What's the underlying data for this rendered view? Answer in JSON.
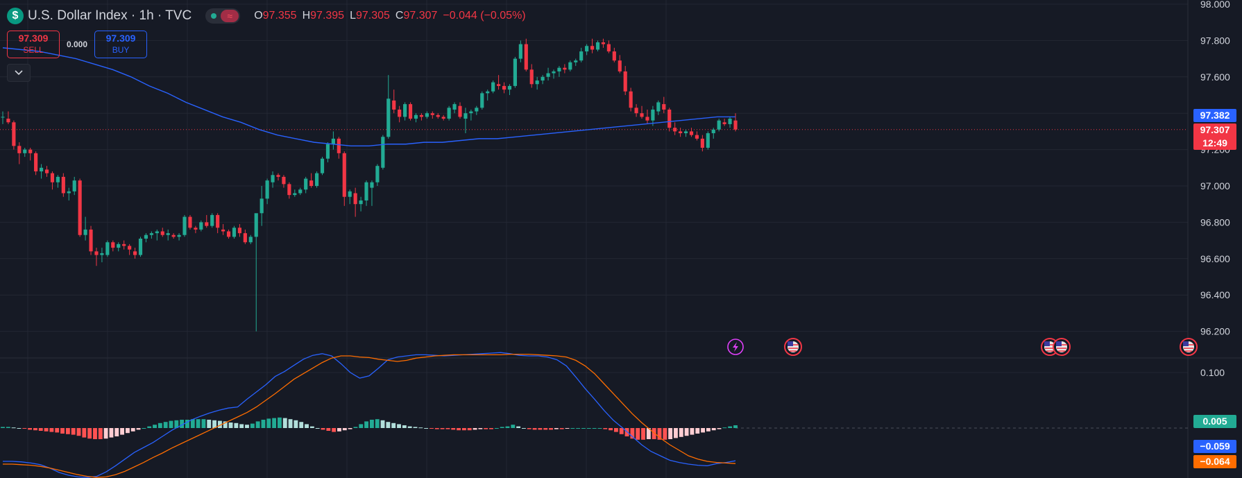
{
  "legend": {
    "logo_glyph": "$",
    "title": "U.S. Dollar Index · 1h · TVC",
    "toggle_glyph": "≈",
    "ohlc": [
      {
        "key": "O",
        "value": "97.355"
      },
      {
        "key": "H",
        "value": "97.395"
      },
      {
        "key": "L",
        "value": "97.305"
      },
      {
        "key": "C",
        "value": "97.307"
      },
      {
        "key": "",
        "value": "−0.044 (−0.05%)"
      }
    ]
  },
  "trade": {
    "sell_price": "97.309",
    "sell_label": "SELL",
    "spread": "0.000",
    "buy_price": "97.309",
    "buy_label": "BUY"
  },
  "collapse_icon": "chevron-down-icon",
  "price_tags": {
    "ma": "97.382",
    "last": "97.307",
    "countdown": "12:49",
    "hist": "0.005",
    "macd": "−0.059",
    "signal": "−0.064"
  },
  "colors": {
    "background": "#161a25",
    "grid": "#232733",
    "up": "#22ab94",
    "down": "#f23645",
    "ma": "#2962ff",
    "macd": "#2962ff",
    "signal": "#ff6d00",
    "hist_up_strong": "#22ab94",
    "hist_up_weak": "#b2dfdb",
    "hist_down_strong": "#ff5252",
    "hist_down_weak": "#ffcdd2",
    "axis_text": "#d1d4dc",
    "event_lightning": "#e040fb",
    "event_flag": "#f23645"
  },
  "chart_data": {
    "type": "candlestick",
    "price_axis": {
      "ticks": [
        "98.000",
        "97.800",
        "97.600",
        "97.400",
        "97.200",
        "97.000",
        "96.800",
        "96.600",
        "96.400",
        "96.200"
      ],
      "range": [
        96.1,
        98.0
      ]
    },
    "candles": [
      [
        97.38,
        97.41,
        97.34,
        97.38
      ],
      [
        97.37,
        97.41,
        97.34,
        97.35
      ],
      [
        97.35,
        97.36,
        97.2,
        97.22
      ],
      [
        97.22,
        97.24,
        97.12,
        97.18
      ],
      [
        97.18,
        97.21,
        97.16,
        97.2
      ],
      [
        97.2,
        97.21,
        97.14,
        97.18
      ],
      [
        97.18,
        97.19,
        97.06,
        97.08
      ],
      [
        97.08,
        97.12,
        97.04,
        97.1
      ],
      [
        97.09,
        97.11,
        97.05,
        97.07
      ],
      [
        97.07,
        97.08,
        96.98,
        97.02
      ],
      [
        97.02,
        97.06,
        96.99,
        97.05
      ],
      [
        97.05,
        97.07,
        96.94,
        96.96
      ],
      [
        96.96,
        96.99,
        96.92,
        96.97
      ],
      [
        96.97,
        97.05,
        96.95,
        97.03
      ],
      [
        97.03,
        97.04,
        96.72,
        96.73
      ],
      [
        96.73,
        96.83,
        96.7,
        96.76
      ],
      [
        96.76,
        96.78,
        96.62,
        96.64
      ],
      [
        96.64,
        96.66,
        96.56,
        96.62
      ],
      [
        96.62,
        96.66,
        96.58,
        96.63
      ],
      [
        96.62,
        96.7,
        96.61,
        96.69
      ],
      [
        96.69,
        96.7,
        96.64,
        96.66
      ],
      [
        96.66,
        96.69,
        96.64,
        96.68
      ],
      [
        96.68,
        96.7,
        96.65,
        96.67
      ],
      [
        96.67,
        96.68,
        96.62,
        96.65
      ],
      [
        96.64,
        96.66,
        96.6,
        96.62
      ],
      [
        96.62,
        96.72,
        96.61,
        96.71
      ],
      [
        96.71,
        96.74,
        96.69,
        96.73
      ],
      [
        96.73,
        96.75,
        96.71,
        96.74
      ],
      [
        96.74,
        96.76,
        96.7,
        96.75
      ],
      [
        96.75,
        96.77,
        96.72,
        96.73
      ],
      [
        96.73,
        96.76,
        96.7,
        96.74
      ],
      [
        96.73,
        96.74,
        96.71,
        96.72
      ],
      [
        96.72,
        96.74,
        96.7,
        96.73
      ],
      [
        96.73,
        96.84,
        96.72,
        96.83
      ],
      [
        96.83,
        96.84,
        96.76,
        96.77
      ],
      [
        96.77,
        96.78,
        96.74,
        96.76
      ],
      [
        96.76,
        96.81,
        96.75,
        96.8
      ],
      [
        96.8,
        96.84,
        96.77,
        96.78
      ],
      [
        96.78,
        96.85,
        96.77,
        96.84
      ],
      [
        96.84,
        96.85,
        96.74,
        96.77
      ],
      [
        96.76,
        96.79,
        96.73,
        96.75
      ],
      [
        96.75,
        96.76,
        96.71,
        96.72
      ],
      [
        96.72,
        96.78,
        96.71,
        96.77
      ],
      [
        96.77,
        96.79,
        96.72,
        96.74
      ],
      [
        96.74,
        96.76,
        96.68,
        96.69
      ],
      [
        96.69,
        96.73,
        96.68,
        96.72
      ],
      [
        96.72,
        96.75,
        96.2,
        96.85
      ],
      [
        96.85,
        97.0,
        96.78,
        96.93
      ],
      [
        96.93,
        97.04,
        96.9,
        97.03
      ],
      [
        97.02,
        97.08,
        96.99,
        97.06
      ],
      [
        97.06,
        97.07,
        97.03,
        97.05
      ],
      [
        97.05,
        97.06,
        96.99,
        97.01
      ],
      [
        97.01,
        97.02,
        96.93,
        96.95
      ],
      [
        96.95,
        96.98,
        96.94,
        96.96
      ],
      [
        96.96,
        96.99,
        96.95,
        96.98
      ],
      [
        96.98,
        97.05,
        96.96,
        97.04
      ],
      [
        97.03,
        97.07,
        96.99,
        97.0
      ],
      [
        97.0,
        97.08,
        96.99,
        97.07
      ],
      [
        97.07,
        97.16,
        97.06,
        97.15
      ],
      [
        97.15,
        97.24,
        97.13,
        97.23
      ],
      [
        97.23,
        97.3,
        97.2,
        97.26
      ],
      [
        97.26,
        97.27,
        97.15,
        97.18
      ],
      [
        97.18,
        97.19,
        96.89,
        96.94
      ],
      [
        96.94,
        96.98,
        96.9,
        96.97
      ],
      [
        96.96,
        96.99,
        96.83,
        96.9
      ],
      [
        96.9,
        96.94,
        96.86,
        96.92
      ],
      [
        96.92,
        97.03,
        96.89,
        97.02
      ],
      [
        96.99,
        97.03,
        96.89,
        97.02
      ],
      [
        97.02,
        97.12,
        97.0,
        97.11
      ],
      [
        97.1,
        97.28,
        97.09,
        97.27
      ],
      [
        97.27,
        97.61,
        97.26,
        97.48
      ],
      [
        97.47,
        97.53,
        97.4,
        97.42
      ],
      [
        97.42,
        97.44,
        97.35,
        97.38
      ],
      [
        97.38,
        97.46,
        97.36,
        97.45
      ],
      [
        97.45,
        97.46,
        97.36,
        97.37
      ],
      [
        97.37,
        97.4,
        97.35,
        97.39
      ],
      [
        97.39,
        97.4,
        97.36,
        97.38
      ],
      [
        97.38,
        97.41,
        97.37,
        97.4
      ],
      [
        97.4,
        97.41,
        97.37,
        97.39
      ],
      [
        97.39,
        97.4,
        97.37,
        97.38
      ],
      [
        97.38,
        97.39,
        97.36,
        97.37
      ],
      [
        97.37,
        97.44,
        97.36,
        97.43
      ],
      [
        97.42,
        97.46,
        97.4,
        97.45
      ],
      [
        97.44,
        97.46,
        97.37,
        97.38
      ],
      [
        97.37,
        97.43,
        97.29,
        97.4
      ],
      [
        97.4,
        97.42,
        97.36,
        97.41
      ],
      [
        97.41,
        97.44,
        97.39,
        97.43
      ],
      [
        97.43,
        97.52,
        97.42,
        97.51
      ],
      [
        97.51,
        97.53,
        97.47,
        97.52
      ],
      [
        97.52,
        97.58,
        97.51,
        97.57
      ],
      [
        97.56,
        97.61,
        97.53,
        97.55
      ],
      [
        97.55,
        97.57,
        97.51,
        97.53
      ],
      [
        97.53,
        97.56,
        97.5,
        97.55
      ],
      [
        97.55,
        97.71,
        97.54,
        97.7
      ],
      [
        97.7,
        97.8,
        97.68,
        97.78
      ],
      [
        97.78,
        97.81,
        97.63,
        97.64
      ],
      [
        97.64,
        97.67,
        97.54,
        97.56
      ],
      [
        97.56,
        97.6,
        97.53,
        97.58
      ],
      [
        97.58,
        97.61,
        97.56,
        97.6
      ],
      [
        97.6,
        97.65,
        97.58,
        97.62
      ],
      [
        97.62,
        97.64,
        97.59,
        97.63
      ],
      [
        97.63,
        97.66,
        97.6,
        97.65
      ],
      [
        97.65,
        97.67,
        97.62,
        97.64
      ],
      [
        97.64,
        97.69,
        97.63,
        97.68
      ],
      [
        97.68,
        97.7,
        97.66,
        97.69
      ],
      [
        97.69,
        97.76,
        97.68,
        97.74
      ],
      [
        97.74,
        97.78,
        97.72,
        97.77
      ],
      [
        97.77,
        97.81,
        97.73,
        97.75
      ],
      [
        97.75,
        97.8,
        97.74,
        97.79
      ],
      [
        97.79,
        97.81,
        97.76,
        97.78
      ],
      [
        97.78,
        97.8,
        97.73,
        97.74
      ],
      [
        97.74,
        97.76,
        97.68,
        97.69
      ],
      [
        97.69,
        97.72,
        97.62,
        97.63
      ],
      [
        97.63,
        97.66,
        97.5,
        97.52
      ],
      [
        97.52,
        97.54,
        97.41,
        97.43
      ],
      [
        97.43,
        97.45,
        97.38,
        97.4
      ],
      [
        97.4,
        97.44,
        97.37,
        97.38
      ],
      [
        97.38,
        97.42,
        97.34,
        97.36
      ],
      [
        97.36,
        97.44,
        97.33,
        97.42
      ],
      [
        97.41,
        97.47,
        97.39,
        97.46
      ],
      [
        97.45,
        97.49,
        97.4,
        97.42
      ],
      [
        97.42,
        97.43,
        97.3,
        97.32
      ],
      [
        97.32,
        97.35,
        97.28,
        97.3
      ],
      [
        97.3,
        97.32,
        97.27,
        97.29
      ],
      [
        97.29,
        97.31,
        97.27,
        97.3
      ],
      [
        97.3,
        97.32,
        97.27,
        97.28
      ],
      [
        97.28,
        97.3,
        97.25,
        97.26
      ],
      [
        97.26,
        97.28,
        97.19,
        97.21
      ],
      [
        97.21,
        97.3,
        97.2,
        97.29
      ],
      [
        97.29,
        97.32,
        97.26,
        97.31
      ],
      [
        97.31,
        97.37,
        97.3,
        97.36
      ],
      [
        97.35,
        97.37,
        97.33,
        97.34
      ],
      [
        97.34,
        97.38,
        97.32,
        97.37
      ],
      [
        97.36,
        97.4,
        97.3,
        97.31
      ]
    ],
    "ma_line": [
      97.76,
      97.75,
      97.74,
      97.72,
      97.7,
      97.67,
      97.64,
      97.6,
      97.55,
      97.51,
      97.46,
      97.42,
      97.38,
      97.35,
      97.31,
      97.28,
      97.26,
      97.24,
      97.23,
      97.22,
      97.22,
      97.23,
      97.23,
      97.24,
      97.24,
      97.25,
      97.26,
      97.26,
      97.27,
      97.28,
      97.29,
      97.3,
      97.31,
      97.32,
      97.33,
      97.34,
      97.35,
      97.36,
      97.37,
      97.38,
      97.38
    ],
    "events": [
      "lightning-icon",
      "us-flag-icon",
      "us-flag-icon",
      "us-flag-icon",
      "us-flag-icon"
    ],
    "macd_axis": {
      "ticks": [
        "0.100"
      ],
      "range": [
        -0.09,
        0.14
      ]
    },
    "macd_histogram": [
      0.002,
      0.002,
      0.001,
      0.0,
      -0.001,
      -0.003,
      -0.004,
      -0.005,
      -0.006,
      -0.007,
      -0.008,
      -0.01,
      -0.011,
      -0.012,
      -0.014,
      -0.017,
      -0.019,
      -0.02,
      -0.02,
      -0.019,
      -0.017,
      -0.015,
      -0.012,
      -0.009,
      -0.006,
      -0.003,
      0.0,
      0.003,
      0.006,
      0.009,
      0.011,
      0.013,
      0.014,
      0.015,
      0.015,
      0.016,
      0.016,
      0.016,
      0.015,
      0.014,
      0.013,
      0.012,
      0.01,
      0.009,
      0.007,
      0.006,
      0.008,
      0.012,
      0.015,
      0.017,
      0.018,
      0.019,
      0.018,
      0.016,
      0.014,
      0.011,
      0.007,
      0.003,
      0.0,
      -0.003,
      -0.005,
      -0.007,
      -0.006,
      -0.004,
      -0.002,
      0.002,
      0.007,
      0.012,
      0.015,
      0.016,
      0.014,
      0.011,
      0.009,
      0.007,
      0.005,
      0.003,
      0.002,
      0.001,
      0.0,
      -0.001,
      -0.002,
      -0.002,
      -0.002,
      -0.003,
      -0.004,
      -0.004,
      -0.004,
      -0.003,
      -0.002,
      -0.002,
      -0.002,
      0.0,
      0.002,
      0.003,
      0.006,
      0.003,
      0.0,
      -0.002,
      -0.003,
      -0.003,
      -0.003,
      -0.003,
      -0.002,
      -0.002,
      -0.001,
      0.0,
      0.0,
      0.0,
      0.0,
      0.0,
      0.0,
      -0.002,
      -0.004,
      -0.007,
      -0.011,
      -0.015,
      -0.019,
      -0.021,
      -0.021,
      -0.02,
      -0.02,
      -0.021,
      -0.021,
      -0.02,
      -0.018,
      -0.016,
      -0.014,
      -0.012,
      -0.01,
      -0.008,
      -0.006,
      -0.004,
      -0.002,
      0.001,
      0.003,
      0.005
    ],
    "macd_line": [
      -0.06,
      -0.06,
      -0.061,
      -0.063,
      -0.066,
      -0.072,
      -0.08,
      -0.085,
      -0.088,
      -0.089,
      -0.087,
      -0.079,
      -0.068,
      -0.056,
      -0.044,
      -0.035,
      -0.026,
      -0.015,
      -0.004,
      0.005,
      0.014,
      0.021,
      0.027,
      0.032,
      0.036,
      0.038,
      0.052,
      0.065,
      0.078,
      0.093,
      0.102,
      0.113,
      0.124,
      0.131,
      0.134,
      0.13,
      0.116,
      0.1,
      0.09,
      0.094,
      0.108,
      0.123,
      0.128,
      0.13,
      0.132,
      0.132,
      0.131,
      0.13,
      0.131,
      0.132,
      0.133,
      0.134,
      0.135,
      0.136,
      0.134,
      0.131,
      0.13,
      0.13,
      0.128,
      0.123,
      0.112,
      0.092,
      0.071,
      0.052,
      0.032,
      0.014,
      0.0,
      -0.015,
      -0.03,
      -0.042,
      -0.05,
      -0.058,
      -0.062,
      -0.065,
      -0.067,
      -0.068,
      -0.064,
      -0.062,
      -0.059
    ],
    "signal_line": [
      -0.065,
      -0.065,
      -0.066,
      -0.067,
      -0.069,
      -0.072,
      -0.076,
      -0.08,
      -0.084,
      -0.087,
      -0.089,
      -0.088,
      -0.084,
      -0.078,
      -0.07,
      -0.062,
      -0.053,
      -0.045,
      -0.036,
      -0.028,
      -0.02,
      -0.012,
      -0.004,
      0.004,
      0.012,
      0.02,
      0.028,
      0.038,
      0.05,
      0.062,
      0.075,
      0.088,
      0.098,
      0.108,
      0.118,
      0.126,
      0.13,
      0.13,
      0.128,
      0.127,
      0.124,
      0.122,
      0.12,
      0.122,
      0.126,
      0.128,
      0.13,
      0.131,
      0.132,
      0.132,
      0.132,
      0.132,
      0.132,
      0.132,
      0.133,
      0.133,
      0.133,
      0.132,
      0.131,
      0.13,
      0.128,
      0.122,
      0.112,
      0.098,
      0.08,
      0.062,
      0.044,
      0.026,
      0.01,
      -0.004,
      -0.018,
      -0.03,
      -0.04,
      -0.05,
      -0.056,
      -0.06,
      -0.062,
      -0.063,
      -0.064
    ]
  }
}
